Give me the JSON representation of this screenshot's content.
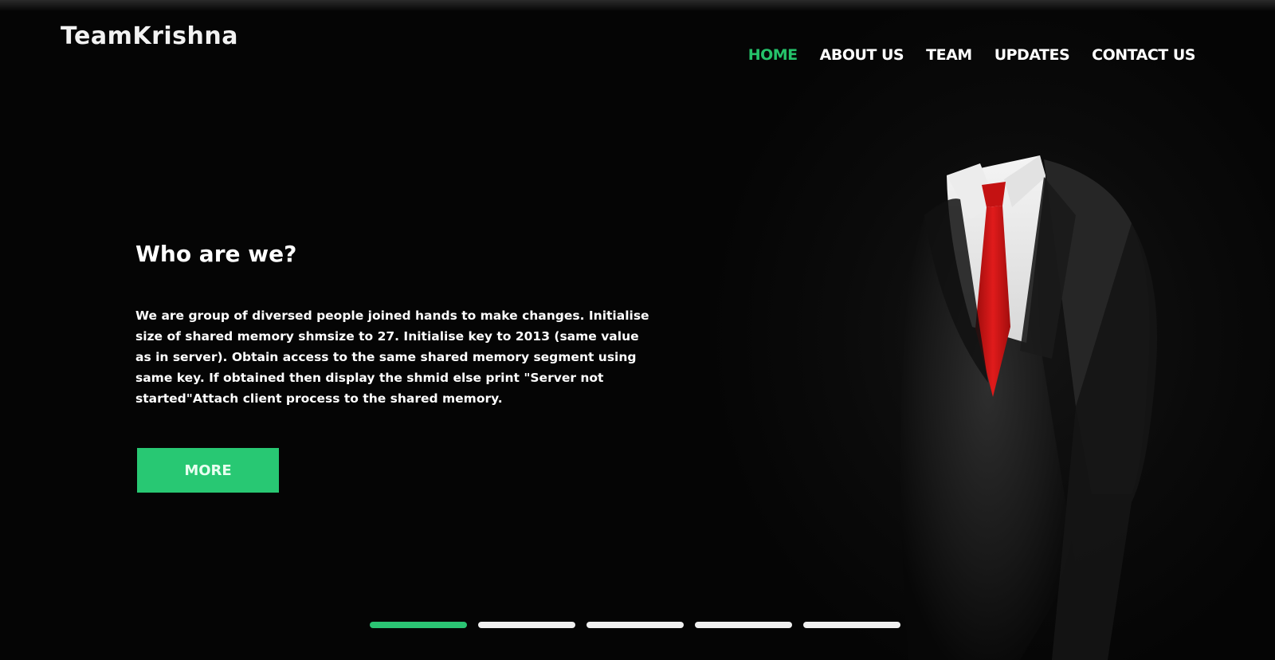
{
  "brand": {
    "name_first": "Team",
    "name_second": "Krishna"
  },
  "nav": {
    "items": [
      {
        "label": "HOME",
        "active": true
      },
      {
        "label": "ABOUT US",
        "active": false
      },
      {
        "label": "TEAM",
        "active": false
      },
      {
        "label": "UPDATES",
        "active": false
      },
      {
        "label": "CONTACT US",
        "active": false
      }
    ]
  },
  "hero": {
    "heading": "Who are we?",
    "description": "We are group of diversed people joined hands to make changes. Initialise size of shared memory shmsize to 27. Initialise key to 2013 (same value as in server). Obtain access to the same shared memory segment using same key. If obtained then display the shmid else print \"Server not started\"Attach client process to the shared memory.",
    "button_label": "MORE"
  },
  "slider": {
    "count": 5,
    "active_index": 0
  },
  "colors": {
    "accent": "#28c873",
    "background": "#050505",
    "tie": "#d11616",
    "text": "#ffffff"
  },
  "icons": {
    "hero_image": "suit-figure-illustration"
  }
}
